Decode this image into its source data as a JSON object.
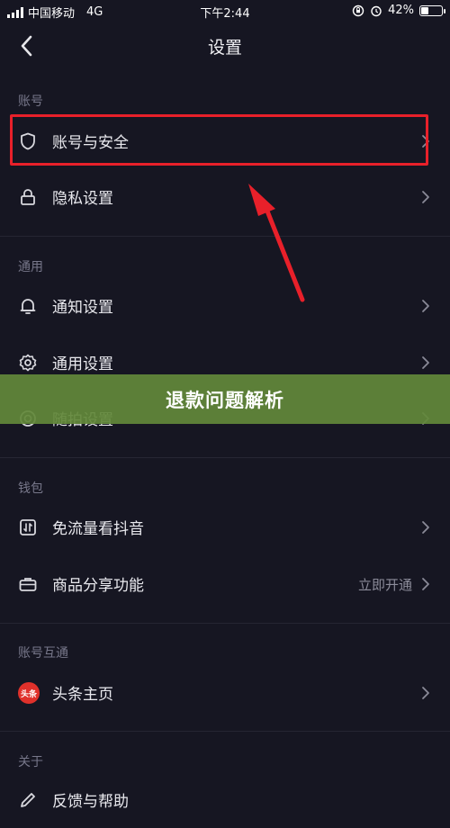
{
  "status_bar": {
    "carrier": "中国移动",
    "network": "4G",
    "time": "下午2:44",
    "battery_text": "42%",
    "battery_level": 0.42
  },
  "nav": {
    "title": "设置"
  },
  "sections": {
    "account": {
      "header": "账号",
      "items": {
        "account_security": "账号与安全",
        "privacy": "隐私设置"
      }
    },
    "general": {
      "header": "通用",
      "items": {
        "notifications": "通知设置",
        "general_settings": "通用设置",
        "capture": "随拍设置"
      }
    },
    "wallet": {
      "header": "钱包",
      "items": {
        "data_free": "免流量看抖音",
        "product_share": "商品分享功能",
        "product_share_value": "立即开通"
      }
    },
    "linked": {
      "header": "账号互通",
      "items": {
        "toutiao": "头条主页",
        "toutiao_logo": "头条"
      }
    },
    "about": {
      "header": "关于",
      "items": {
        "feedback": "反馈与帮助"
      }
    }
  },
  "banner": {
    "text": "退款问题解析"
  },
  "colors": {
    "background": "#161622",
    "highlight": "#e8202a",
    "banner": "#62883a"
  }
}
